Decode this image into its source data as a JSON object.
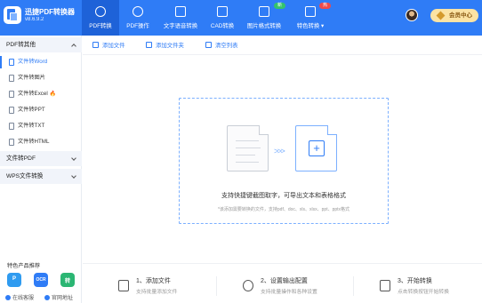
{
  "app": {
    "name": "迅捷PDF转换器",
    "version": "v8.6.9.2"
  },
  "nav": {
    "tabs": [
      {
        "label": "PDF转换"
      },
      {
        "label": "PDF操作"
      },
      {
        "label": "文字语音转换"
      },
      {
        "label": "CAD转换"
      },
      {
        "label": "图片格式转换",
        "badge": "新"
      },
      {
        "label": "特色转换 ▾",
        "badge": "热"
      }
    ]
  },
  "header": {
    "member_label": "会员中心"
  },
  "sidebar": {
    "sections": [
      {
        "label": "PDF转其他"
      },
      {
        "label": "文件转PDF"
      },
      {
        "label": "WPS文件转换"
      }
    ],
    "items": [
      {
        "label": "文件转Word"
      },
      {
        "label": "文件转图片"
      },
      {
        "label": "文件转Excel",
        "hot": "🔥"
      },
      {
        "label": "文件转PPT"
      },
      {
        "label": "文件转TXT"
      },
      {
        "label": "文件转HTML"
      }
    ],
    "featured_title": "特色产品推荐",
    "featured_apps": [
      {
        "label": "P"
      },
      {
        "label": "OCR"
      },
      {
        "label": "转"
      }
    ],
    "footer": {
      "left": "在线客服",
      "right": "官网地址"
    }
  },
  "toolbar": {
    "add_file": "添加文件",
    "add_folder": "添加文件夹",
    "clear_list": "清空列表"
  },
  "dropzone": {
    "arrows": "> > >",
    "plus": "+",
    "main_text": "支持快捷键截图取字，可导出文本和表格格式",
    "sub_text": "*该添加需要转换的文件，支持pdf、doc、xls、xlsx、ppt、pptx格式"
  },
  "steps": [
    {
      "title": "1、添加文件",
      "desc": "支持批量添加文件"
    },
    {
      "title": "2、设置输出配置",
      "desc": "支持批量操作和各种设置"
    },
    {
      "title": "3、开始转换",
      "desc": "点击转换按钮开始转换"
    }
  ],
  "colors": {
    "primary": "#2f7cf6",
    "active_tab": "#1e62d8",
    "badge_new": "#34c36b",
    "badge_hot": "#f04a4a",
    "member_bg": "#fbe3a4"
  }
}
